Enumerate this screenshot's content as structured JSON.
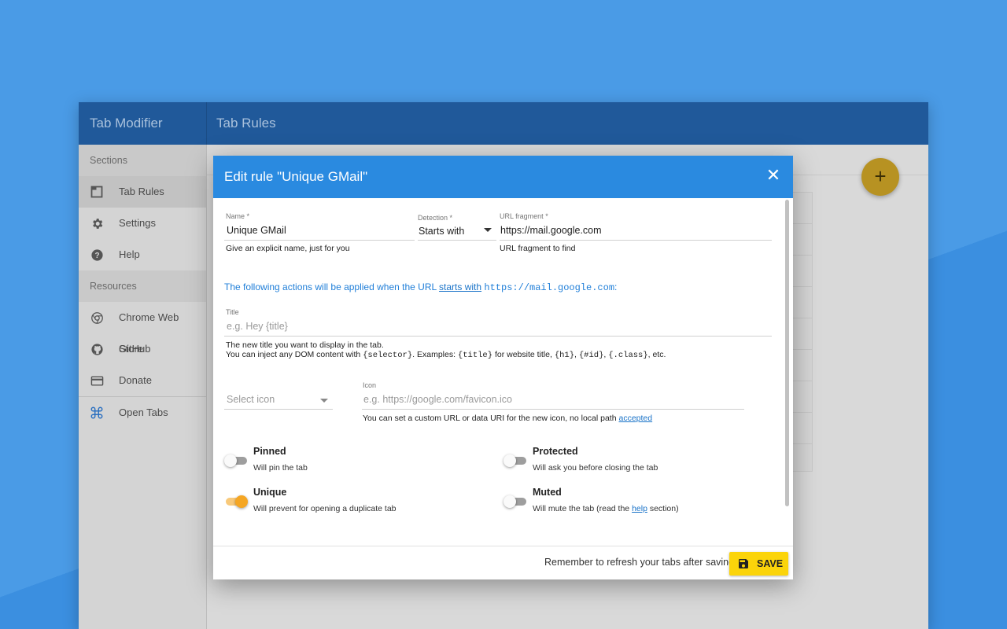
{
  "app": {
    "title": "Tab Modifier",
    "page_title": "Tab Rules",
    "fab_label": "+"
  },
  "sidebar": {
    "sections_heading": "Sections",
    "items": [
      {
        "label": "Tab Rules",
        "icon": "tab-icon"
      },
      {
        "label": "Settings",
        "icon": "gear-icon"
      },
      {
        "label": "Help",
        "icon": "help-icon"
      }
    ],
    "resources_heading": "Resources",
    "resources": [
      {
        "label": "Chrome Web Store",
        "icon": "chrome-icon"
      },
      {
        "label": "GitHub",
        "icon": "github-icon"
      },
      {
        "label": "Donate",
        "icon": "card-icon"
      }
    ],
    "open_tabs": {
      "label": "Open Tabs",
      "icon": "command-icon"
    }
  },
  "dialog": {
    "title": "Edit rule \"Unique GMail\"",
    "close": "✕",
    "name": {
      "label": "Name *",
      "value": "Unique GMail",
      "helper": "Give an explicit name, just for you"
    },
    "detection": {
      "label": "Detection *",
      "value": "Starts with"
    },
    "url_fragment": {
      "label": "URL fragment *",
      "value": "https://mail.google.com",
      "helper": "URL fragment to find"
    },
    "info": {
      "prefix": "The following actions will be applied when the URL ",
      "link": "starts with",
      "url": "https://mail.google.com",
      "suffix": ":"
    },
    "title_field": {
      "label": "Title",
      "placeholder": "e.g. Hey {title}",
      "helper_line1": "The new title you want to display in the tab.",
      "helper_line2_a": "You can inject any DOM content with ",
      "helper_line2_code1": "{selector}",
      "helper_line2_b": ". Examples: ",
      "helper_line2_code2": "{title}",
      "helper_line2_c": " for website title, ",
      "helper_line2_code3": "{h1}",
      "helper_line2_d": ", ",
      "helper_line2_code4": "{#id}",
      "helper_line2_e": ", ",
      "helper_line2_code5": "{.class}",
      "helper_line2_f": ", etc."
    },
    "icon_select": {
      "placeholder": "Select icon"
    },
    "icon_field": {
      "label": "Icon",
      "placeholder": "e.g. https://google.com/favicon.ico",
      "helper": "You can set a custom URL or data URI for the new icon, no local path ",
      "helper_link": "accepted"
    },
    "options": {
      "pinned": {
        "title": "Pinned",
        "desc": "Will pin the tab",
        "on": false
      },
      "protected": {
        "title": "Protected",
        "desc": "Will ask you before closing the tab",
        "on": false
      },
      "unique": {
        "title": "Unique",
        "desc": "Will prevent for opening a duplicate tab",
        "on": true
      },
      "muted": {
        "title": "Muted",
        "desc_a": "Will mute the tab (read the ",
        "desc_link": "help",
        "desc_b": " section)",
        "on": false
      }
    },
    "footer": {
      "note": "Remember to refresh your tabs after saving",
      "save": "SAVE"
    }
  },
  "colors": {
    "page_bg": "#4a9be6",
    "header": "#20599a",
    "dialog_header": "#2a8ae0",
    "save_button": "#fbd40a",
    "toggle_on": "#f5a623",
    "fab": "#b79222"
  }
}
